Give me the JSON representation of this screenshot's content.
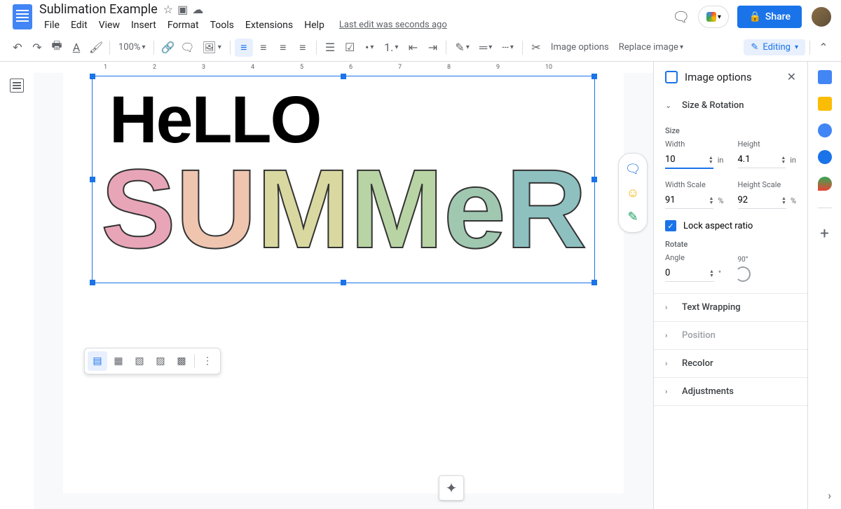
{
  "doc": {
    "title": "Sublimation Example",
    "last_edit": "Last edit was seconds ago"
  },
  "menu": [
    "File",
    "Edit",
    "View",
    "Insert",
    "Format",
    "Tools",
    "Extensions",
    "Help"
  ],
  "toolbar": {
    "zoom": "100%",
    "image_options": "Image options",
    "replace_image": "Replace image",
    "editing": "Editing"
  },
  "share": {
    "label": "Share"
  },
  "sidebar": {
    "title": "Image options",
    "sections": {
      "size_rotation": "Size & Rotation",
      "text_wrapping": "Text Wrapping",
      "position": "Position",
      "recolor": "Recolor",
      "adjustments": "Adjustments"
    },
    "size": {
      "heading": "Size",
      "width_label": "Width",
      "width_value": "10",
      "width_unit": "in",
      "height_label": "Height",
      "height_value": "4.1",
      "height_unit": "in",
      "width_scale_label": "Width Scale",
      "width_scale_value": "91",
      "width_scale_unit": "%",
      "height_scale_label": "Height Scale",
      "height_scale_value": "92",
      "height_scale_unit": "%",
      "lock_aspect": "Lock aspect ratio"
    },
    "rotate": {
      "heading": "Rotate",
      "angle_label": "Angle",
      "angle_value": "0",
      "angle_unit": "°",
      "ninety_label": "90°"
    }
  },
  "ruler_marks": [
    "1",
    "2",
    "3",
    "4",
    "5",
    "6",
    "7",
    "8",
    "9",
    "10"
  ],
  "image_content": {
    "line1": "HeLLO",
    "line2": "SUMMeR"
  }
}
